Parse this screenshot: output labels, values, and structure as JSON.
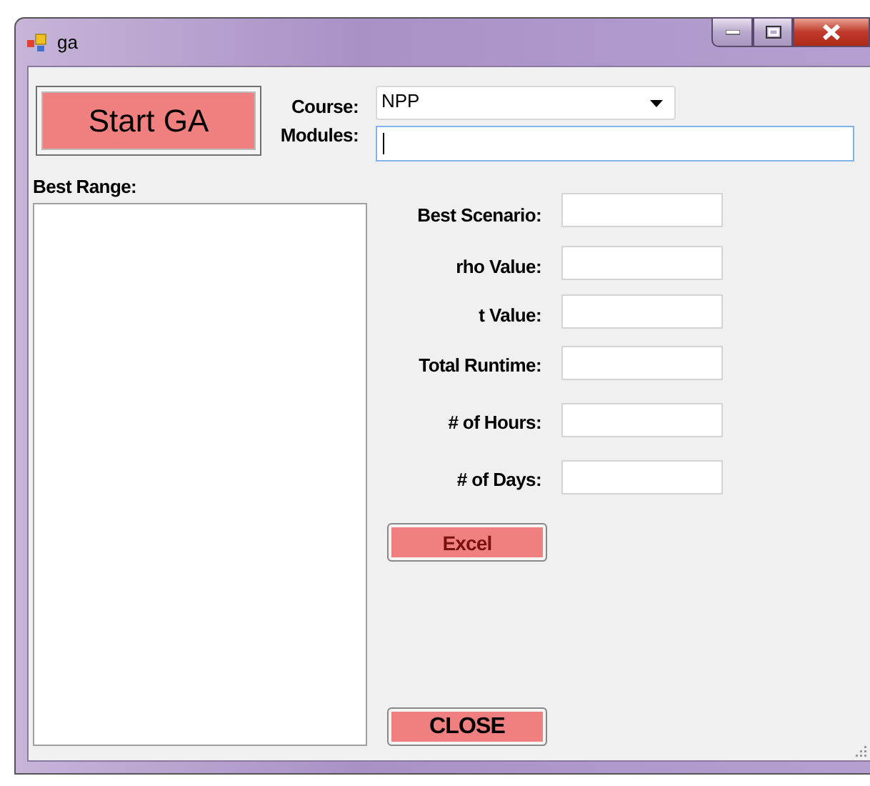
{
  "window": {
    "title": "ga"
  },
  "start_button": {
    "label": "Start GA"
  },
  "course": {
    "label": "Course:",
    "value": "NPP"
  },
  "modules": {
    "label": "Modules:"
  },
  "best_range": {
    "label": "Best Range:"
  },
  "results": [
    {
      "label": "Best Scenario:"
    },
    {
      "label": "rho Value:"
    },
    {
      "label": "t Value:"
    },
    {
      "label": "Total Runtime:"
    },
    {
      "label": "# of Hours:"
    },
    {
      "label": "# of Days:"
    }
  ],
  "excel_button": {
    "label": "Excel"
  },
  "close_button": {
    "label": "CLOSE"
  }
}
